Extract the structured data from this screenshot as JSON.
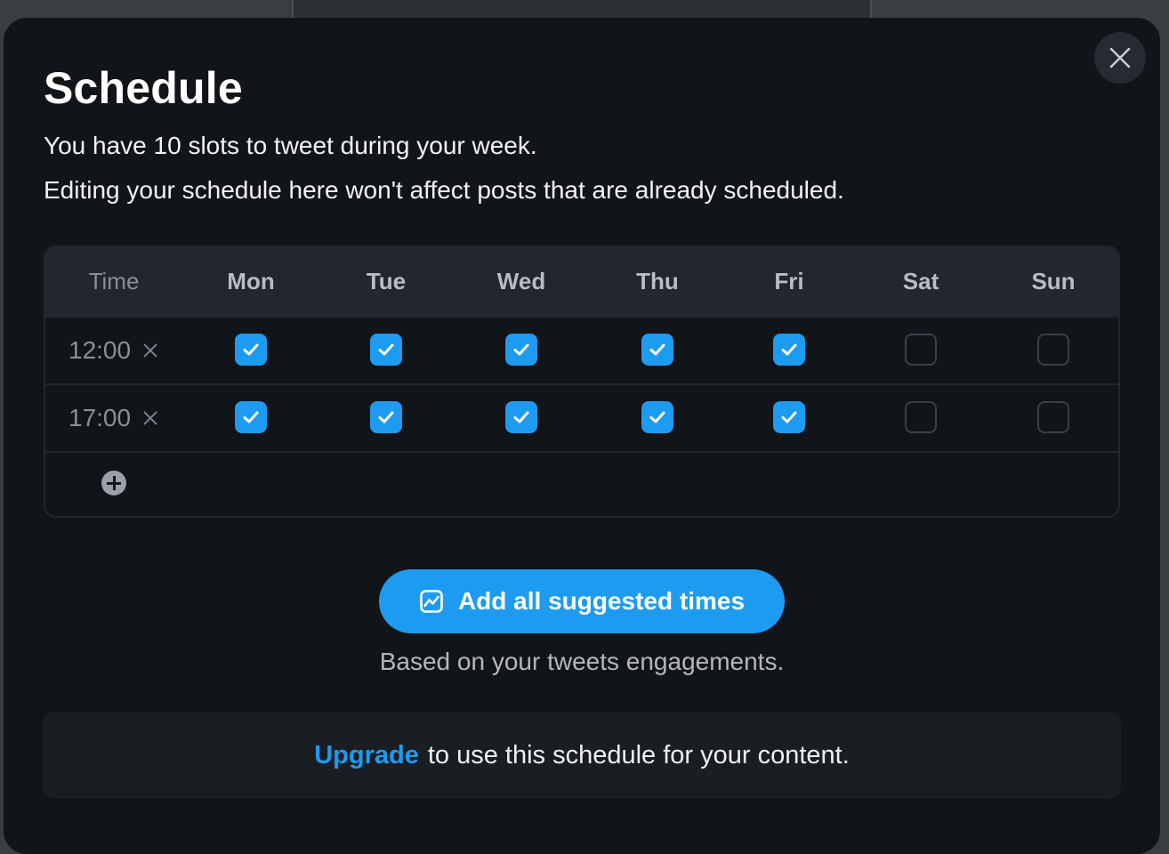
{
  "modal": {
    "title": "Schedule",
    "subtitle_1": "You have 10 slots to tweet during your week.",
    "subtitle_2": "Editing your schedule here won't affect posts that are already scheduled."
  },
  "grid": {
    "time_header": "Time",
    "days": [
      "Mon",
      "Tue",
      "Wed",
      "Thu",
      "Fri",
      "Sat",
      "Sun"
    ],
    "rows": [
      {
        "time": "12:00",
        "checked": [
          true,
          true,
          true,
          true,
          true,
          false,
          false
        ]
      },
      {
        "time": "17:00",
        "checked": [
          true,
          true,
          true,
          true,
          true,
          false,
          false
        ]
      }
    ]
  },
  "actions": {
    "suggest_button_label": "Add all suggested times",
    "suggest_note": "Based on your tweets engagements."
  },
  "upgrade": {
    "link_label": "Upgrade",
    "message": "to use this schedule for your content."
  },
  "colors": {
    "accent": "#1d9bf0",
    "modal_bg": "#111418"
  },
  "icons": {
    "close": "close-icon",
    "remove_time": "x-icon",
    "add_time": "plus-circle-icon",
    "suggest": "chart-icon",
    "check": "check-icon"
  }
}
